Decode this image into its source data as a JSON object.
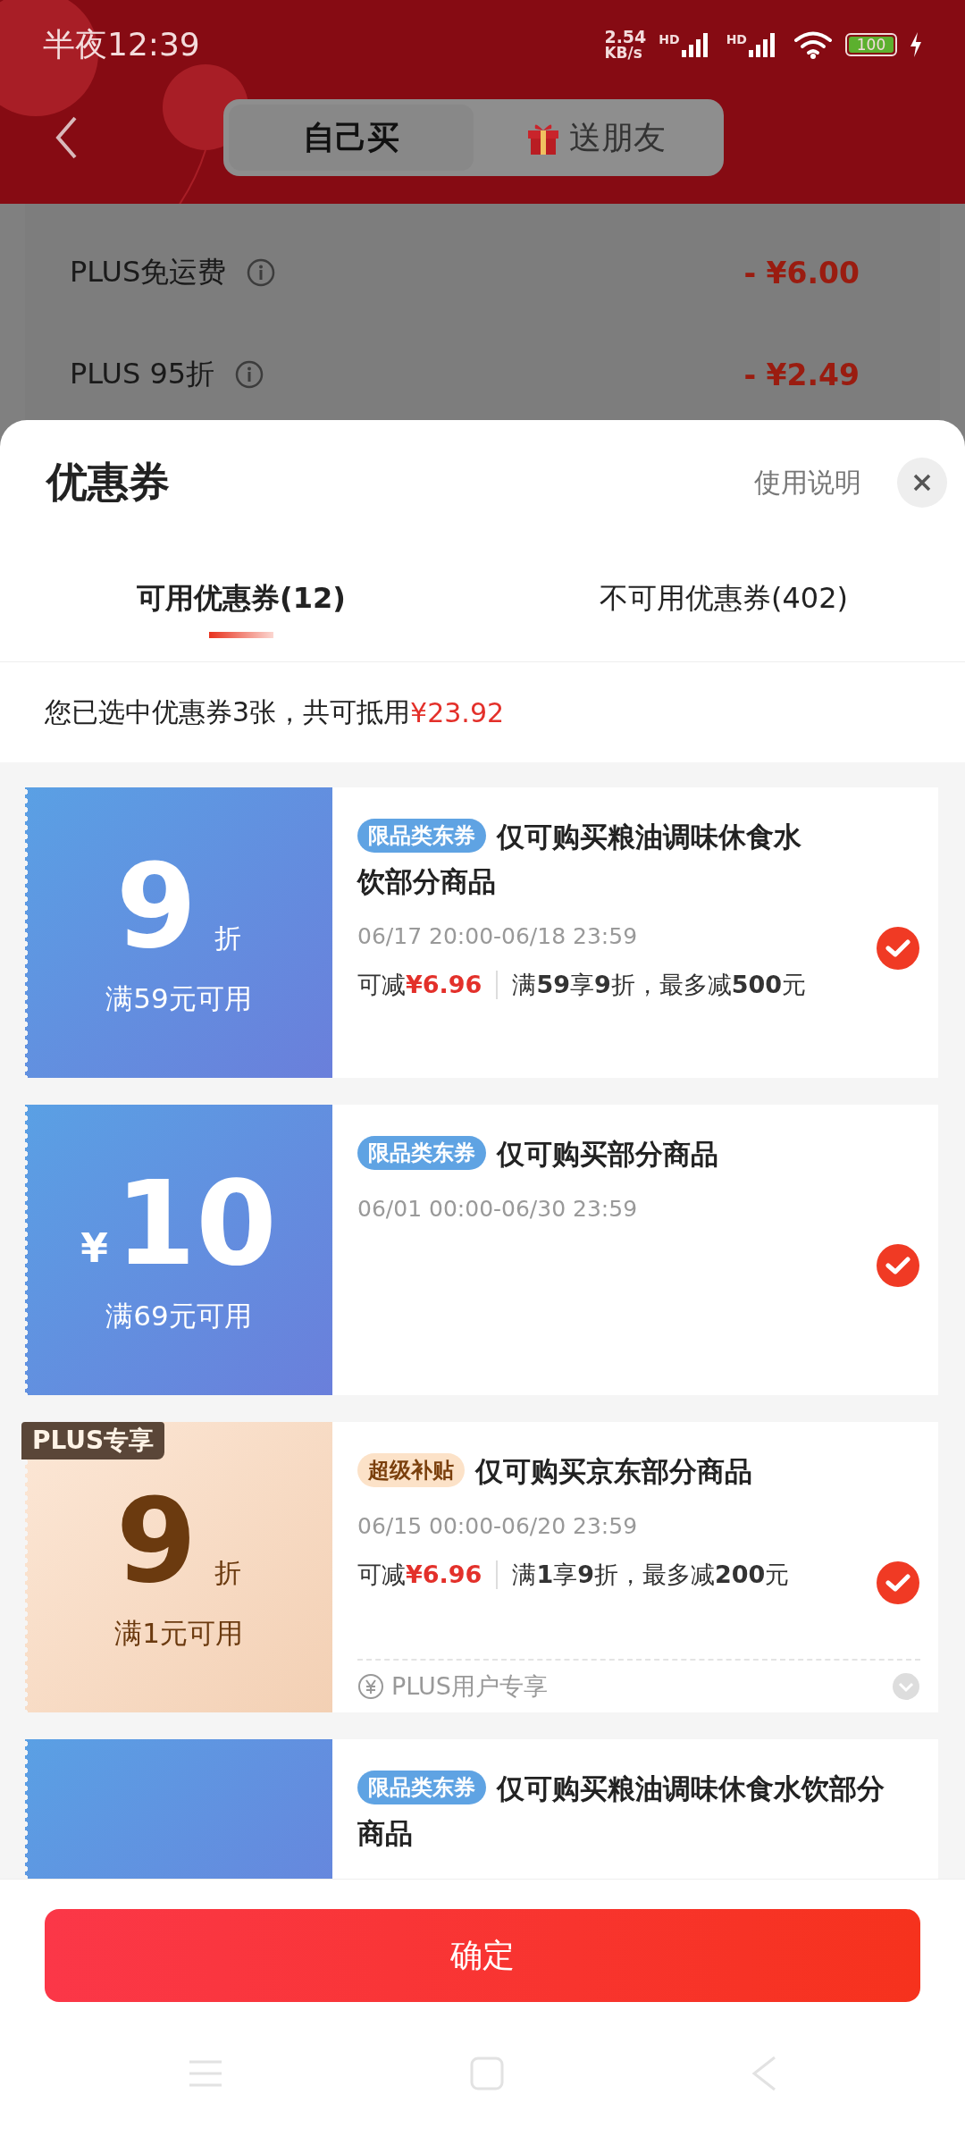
{
  "status_bar": {
    "time": "半夜12:39",
    "speed_value": "2.54",
    "speed_unit": "KB/s",
    "signal_labels": [
      "HD",
      "HD"
    ],
    "battery": "100"
  },
  "header": {
    "tabs": [
      {
        "label": "自己买",
        "selected": true,
        "gift_icon": false
      },
      {
        "label": "送朋友",
        "selected": false,
        "gift_icon": true
      }
    ]
  },
  "background_rows": [
    {
      "label": "PLUS免运费",
      "amount": "- ¥6.00"
    },
    {
      "label": "PLUS 95折",
      "amount": "- ¥2.49"
    }
  ],
  "sheet": {
    "title": "优惠券",
    "help": "使用说明",
    "tabs": [
      {
        "label": "可用优惠券(12)",
        "selected": true
      },
      {
        "label": "不可用优惠券(402)",
        "selected": false
      }
    ],
    "summary": {
      "text": "您已选中优惠券3张，共可抵用",
      "amount": "¥23.92"
    },
    "coupons": [
      {
        "kind": "blue",
        "value": "9",
        "unit": "折",
        "condition": "满59元可用",
        "tag": "限品类东券",
        "title": "仅可购买粮油调味休食水饮部分商品",
        "period": "06/17 20:00-06/18 23:59",
        "saving_label": "可减",
        "saving": "¥6.96",
        "rule": "满**59**享**9**折，最多减**500**元",
        "selected": true
      },
      {
        "kind": "blue",
        "prefix": "¥",
        "value": "10",
        "condition": "满69元可用",
        "tag": "限品类东券",
        "title": "仅可购买部分商品",
        "period": "06/01 00:00-06/30 23:59",
        "selected": true
      },
      {
        "kind": "plus",
        "ribbon": "PLUS专享",
        "value": "9",
        "unit": "折",
        "condition": "满1元可用",
        "tag": "超级补贴",
        "title": "仅可购买京东部分商品",
        "period": "06/15 00:00-06/20 23:59",
        "saving_label": "可减",
        "saving": "¥6.96",
        "rule": "满**1**享**9**折，最多减**200**元",
        "note": "PLUS用户专享",
        "selected": true
      },
      {
        "kind": "blue",
        "tag": "限品类东券",
        "title": "仅可购买粮油调味休食水饮部分商品"
      }
    ],
    "confirm": "确定"
  }
}
